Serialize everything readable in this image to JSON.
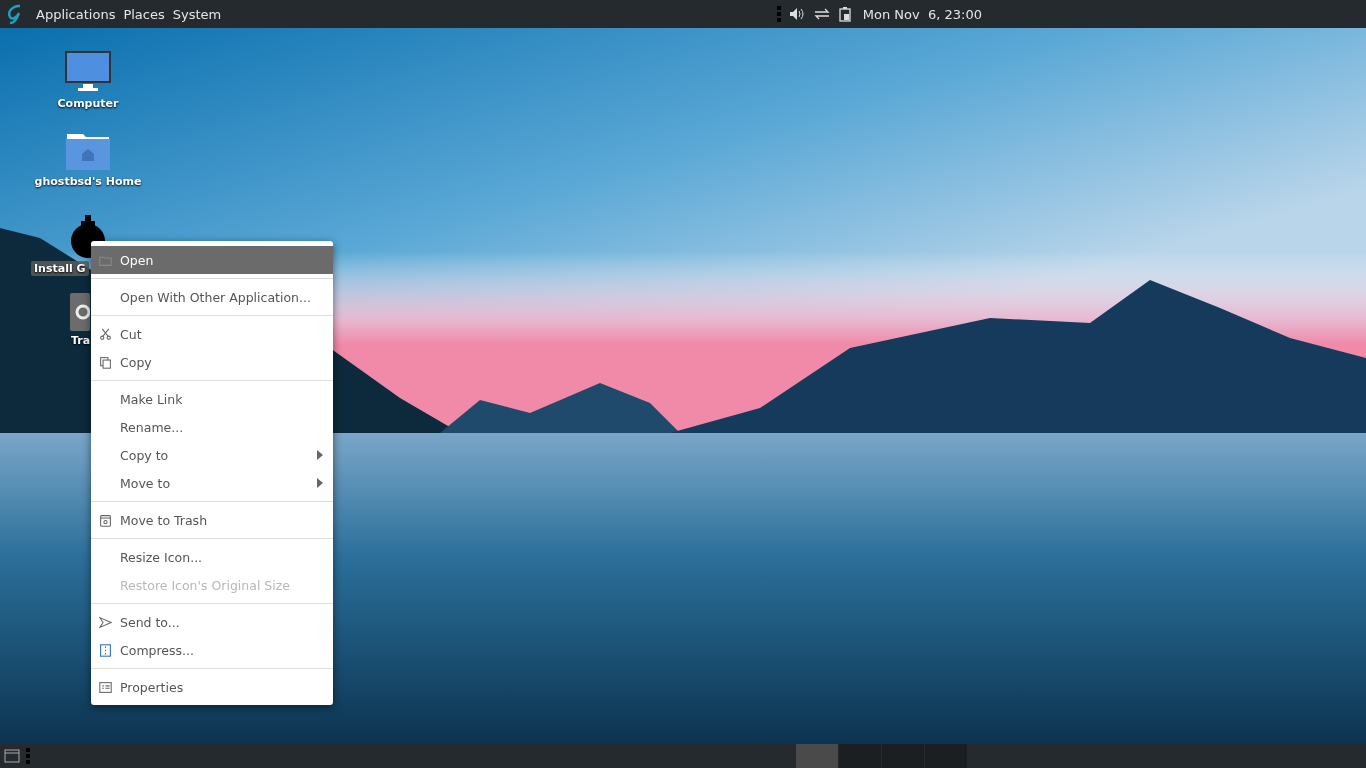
{
  "top_panel": {
    "menus": [
      "Applications",
      "Places",
      "System"
    ],
    "clock": "Mon Nov  6, 23:00"
  },
  "desktop_icons": [
    {
      "kind": "computer",
      "label": "Computer"
    },
    {
      "kind": "home",
      "label": "ghostbsd's Home"
    },
    {
      "kind": "installer",
      "label": "Install G",
      "selected": true
    },
    {
      "kind": "trash",
      "label": "Tra",
      "selected": false
    }
  ],
  "context_menu": {
    "groups": [
      [
        {
          "kind": "folder",
          "label": "Open",
          "selected": true,
          "disabled": false,
          "submenu": false
        }
      ],
      [
        {
          "kind": "plain",
          "label": "Open With Other Application...",
          "selected": false,
          "disabled": false,
          "submenu": false
        }
      ],
      [
        {
          "kind": "scissors",
          "label": "Cut",
          "selected": false,
          "disabled": false,
          "submenu": false
        },
        {
          "kind": "copy",
          "label": "Copy",
          "selected": false,
          "disabled": false,
          "submenu": false
        }
      ],
      [
        {
          "kind": "plain",
          "label": "Make Link",
          "selected": false,
          "disabled": false,
          "submenu": false
        },
        {
          "kind": "plain",
          "label": "Rename...",
          "selected": false,
          "disabled": false,
          "submenu": false
        },
        {
          "kind": "plain",
          "label": "Copy to",
          "selected": false,
          "disabled": false,
          "submenu": true
        },
        {
          "kind": "plain",
          "label": "Move to",
          "selected": false,
          "disabled": false,
          "submenu": true
        }
      ],
      [
        {
          "kind": "trash",
          "label": "Move to Trash",
          "selected": false,
          "disabled": false,
          "submenu": false
        }
      ],
      [
        {
          "kind": "plain",
          "label": "Resize Icon...",
          "selected": false,
          "disabled": false,
          "submenu": false
        },
        {
          "kind": "plain",
          "label": "Restore Icon's Original Size",
          "selected": false,
          "disabled": true,
          "submenu": false
        }
      ],
      [
        {
          "kind": "send",
          "label": "Send to...",
          "selected": false,
          "disabled": false,
          "submenu": false
        },
        {
          "kind": "archive",
          "label": "Compress...",
          "selected": false,
          "disabled": false,
          "submenu": false
        }
      ],
      [
        {
          "kind": "properties",
          "label": "Properties",
          "selected": false,
          "disabled": false,
          "submenu": false
        }
      ]
    ]
  },
  "bottom_panel": {
    "workspaces": [
      {
        "selected": true
      },
      {
        "selected": false
      },
      {
        "selected": false
      },
      {
        "selected": false
      }
    ]
  }
}
